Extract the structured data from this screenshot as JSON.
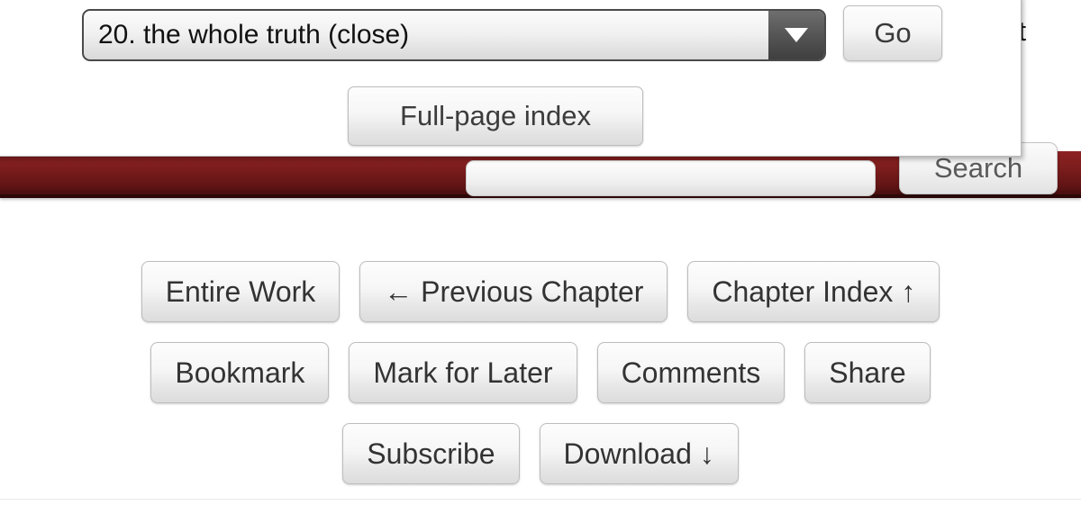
{
  "header": {
    "search_field_value": "",
    "search_button_label": "Search",
    "logout_link_label": "out"
  },
  "dropdown_panel": {
    "chapter_select": {
      "selected_option": "20. the whole truth (close)",
      "caret_icon": "chevron-down-icon"
    },
    "go_button_label": "Go",
    "fullpage_index_button_label": "Full-page index"
  },
  "navigation": {
    "row1": [
      {
        "label": "Entire Work",
        "name": "entire-work-button"
      },
      {
        "label": "← Previous Chapter",
        "name": "previous-chapter-button"
      },
      {
        "label": "Chapter Index ↑",
        "name": "chapter-index-button"
      }
    ],
    "row2": [
      {
        "label": "Bookmark",
        "name": "bookmark-button"
      },
      {
        "label": "Mark for Later",
        "name": "mark-for-later-button"
      },
      {
        "label": "Comments",
        "name": "comments-button"
      },
      {
        "label": "Share",
        "name": "share-button"
      }
    ],
    "row3": [
      {
        "label": "Subscribe",
        "name": "subscribe-button"
      },
      {
        "label": "Download ↓",
        "name": "download-button"
      }
    ]
  },
  "colors": {
    "header_red_top": "#8d2222",
    "header_red_bottom": "#3d0b0b",
    "button_face": "#f2f2f2",
    "button_border": "#bdbdbd",
    "text_primary": "#333333"
  }
}
